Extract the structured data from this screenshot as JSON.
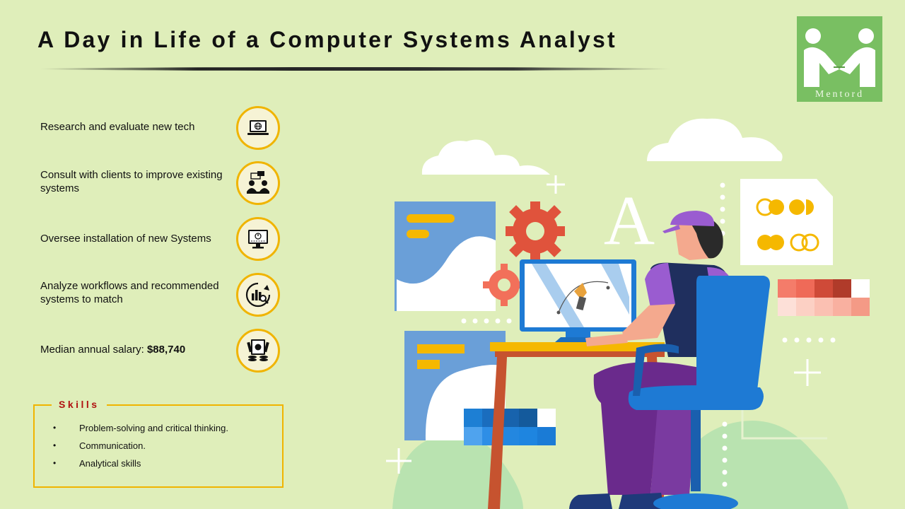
{
  "title": "A Day in Life of a Computer Systems Analyst",
  "logo": {
    "text": "Mentord"
  },
  "tasks": [
    {
      "text": "Research and evaluate new tech",
      "icon": "laptop-globe-icon"
    },
    {
      "text": "Consult with clients to improve existing systems",
      "icon": "consultation-icon"
    },
    {
      "text": "Oversee installation of new Systems",
      "icon": "monitor-install-icon"
    },
    {
      "text": "Analyze workflows and recommended systems to match",
      "icon": "analytics-magnifier-icon"
    },
    {
      "text_prefix": "Median annual salary: ",
      "text_value": "$88,740",
      "icon": "money-coins-icon"
    }
  ],
  "skills": {
    "heading": "Skills",
    "items": [
      "Problem-solving and critical thinking.",
      "Communication.",
      "Analytical skills"
    ]
  },
  "illustration": {
    "letter": "A"
  },
  "colors": {
    "background": "#dfeeba",
    "accent": "#f0b400",
    "skills_heading": "#b01010",
    "logo": "#79bf62"
  }
}
